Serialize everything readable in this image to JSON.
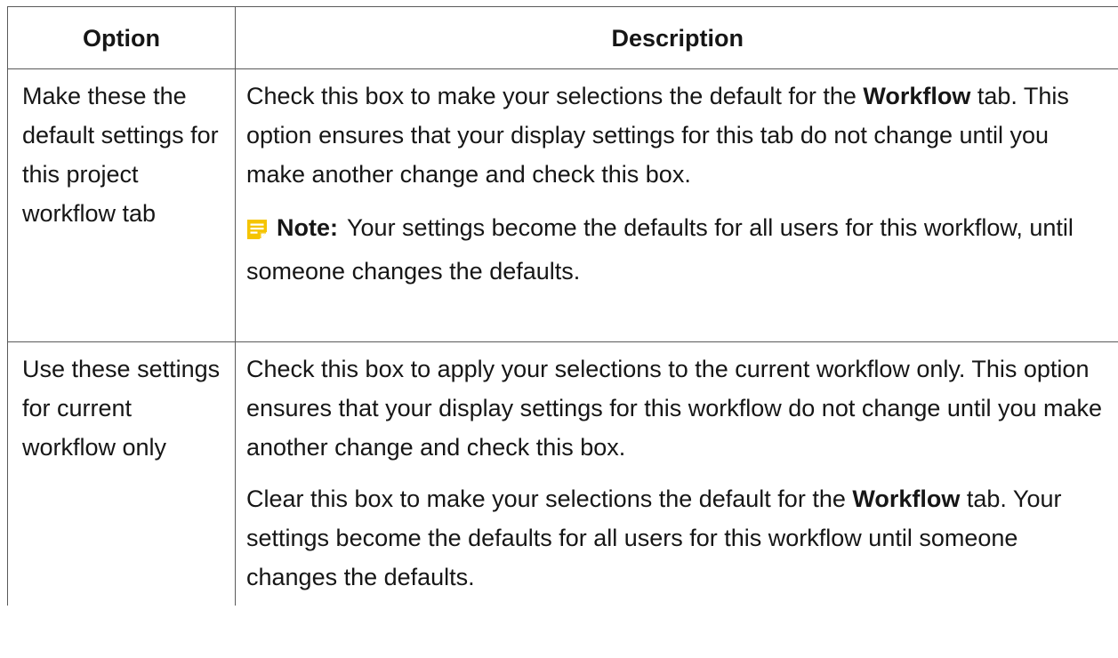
{
  "table": {
    "headers": {
      "option": "Option",
      "description": "Description"
    },
    "rows": [
      {
        "option": "Make these the default settings for this project workflow tab",
        "desc1_before": "Check this box to make your selections the default for the ",
        "desc1_bold": "Workflow",
        "desc1_after": " tab. This option ensures that your display settings for this tab do not change until you make another change and check this box.",
        "note_label": "Note:",
        "note_text": "Your settings become the defaults for all users for this workflow, until someone changes the defaults."
      },
      {
        "option": "Use these settings for current workflow only",
        "desc1": "Check this box to apply your selections to the current workflow only. This option ensures that your display settings for this workflow do not change until you make another change and check this box.",
        "desc2_before": "Clear this box to make your selections the default for the ",
        "desc2_bold": "Workflow",
        "desc2_after": " tab. Your settings become the defaults for all users for this workflow until someone changes the defaults."
      }
    ]
  },
  "colors": {
    "note_icon": "#f5c400",
    "border": "#5a5a5a",
    "text": "#161616"
  },
  "icons": {
    "note": "note-icon"
  }
}
